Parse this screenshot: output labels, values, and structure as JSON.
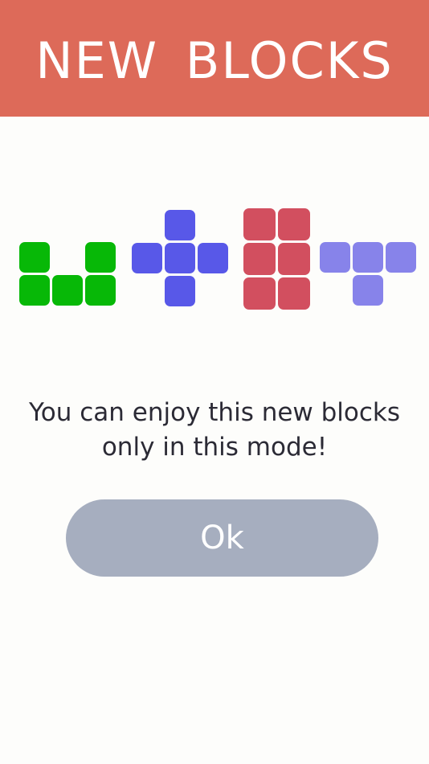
{
  "header": {
    "title": "NEW BLOCKS",
    "background_color": "#dd6a59"
  },
  "pieces": [
    {
      "name": "green-u-block",
      "color": "#07b807",
      "cells": [
        [
          0,
          0
        ],
        [
          2,
          0
        ],
        [
          0,
          1
        ],
        [
          1,
          1
        ],
        [
          2,
          1
        ]
      ]
    },
    {
      "name": "blue-plus-block",
      "color": "#5858e8",
      "cells": [
        [
          1,
          0
        ],
        [
          0,
          1
        ],
        [
          1,
          1
        ],
        [
          2,
          1
        ],
        [
          1,
          2
        ]
      ]
    },
    {
      "name": "red-rect-block",
      "color": "#d24f5f",
      "cells": [
        [
          0,
          0
        ],
        [
          1,
          0
        ],
        [
          0,
          1
        ],
        [
          1,
          1
        ],
        [
          0,
          2
        ],
        [
          1,
          2
        ]
      ]
    },
    {
      "name": "purple-t-block",
      "color": "#8783ea",
      "cells": [
        [
          0,
          0
        ],
        [
          1,
          0
        ],
        [
          2,
          0
        ],
        [
          1,
          1
        ]
      ]
    }
  ],
  "message": {
    "line1": "You can enjoy this new blocks",
    "line2": "only in this mode!"
  },
  "ok_button": {
    "label": "Ok",
    "color": "#a6aebf"
  }
}
